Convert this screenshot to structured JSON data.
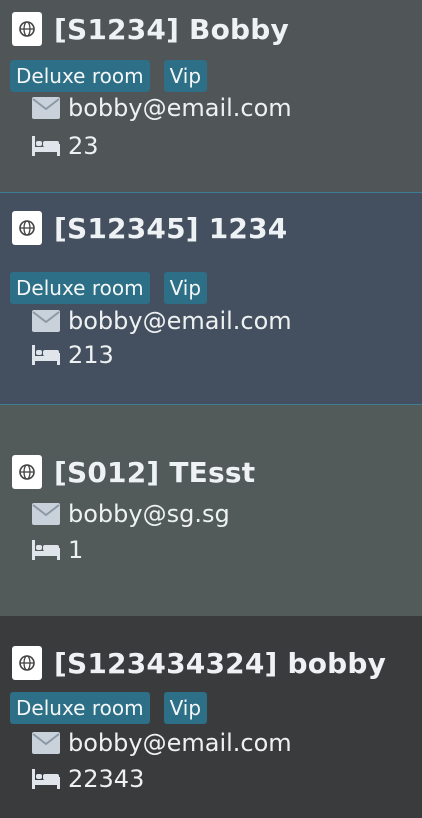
{
  "guests": [
    {
      "room_code": "[S1234]",
      "name": "Bobby",
      "tags": [
        "Deluxe room",
        "Vip"
      ],
      "email": "bobby@email.com",
      "room_number": "23"
    },
    {
      "room_code": "[S12345]",
      "name": "1234",
      "tags": [
        "Deluxe room",
        "Vip"
      ],
      "email": "bobby@email.com",
      "room_number": "213"
    },
    {
      "room_code": "[S012]",
      "name": "TEsst",
      "tags": [],
      "email": "bobby@sg.sg",
      "room_number": "1"
    },
    {
      "room_code": "[S123434324]",
      "name": "bobby",
      "tags": [
        "Deluxe room",
        "Vip"
      ],
      "email": "bobby@email.com",
      "room_number": "22343"
    }
  ],
  "colors": {
    "card_bg_1": "#505557",
    "card_bg_selected": "#44505f",
    "card_bg_3": "#525a5a",
    "card_bg_4": "#3a3b3c",
    "tag_bg": "#2d6f86",
    "selected_border": "#3d7e93"
  },
  "icons": {
    "title": "passport-icon",
    "email": "envelope-icon",
    "room": "bed-icon"
  }
}
